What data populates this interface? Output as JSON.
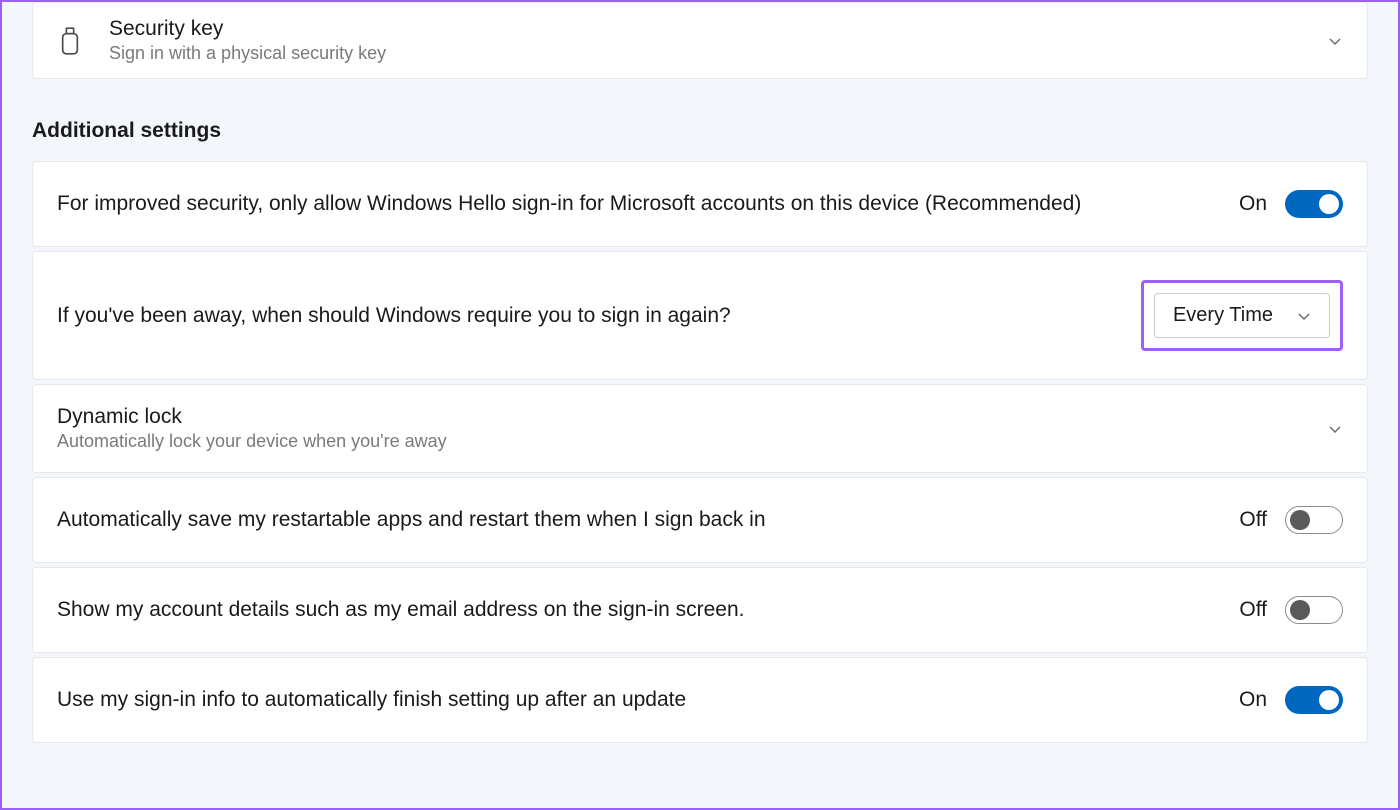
{
  "securityKey": {
    "title": "Security key",
    "subtitle": "Sign in with a physical security key"
  },
  "sectionHeading": "Additional settings",
  "helloSignIn": {
    "text": "For improved security, only allow Windows Hello sign-in for Microsoft accounts on this device (Recommended)",
    "stateLabel": "On"
  },
  "requireSignIn": {
    "text": "If you've been away, when should Windows require you to sign in again?",
    "dropdownValue": "Every Time"
  },
  "dynamicLock": {
    "title": "Dynamic lock",
    "subtitle": "Automatically lock your device when you're away"
  },
  "restartableApps": {
    "text": "Automatically save my restartable apps and restart them when I sign back in",
    "stateLabel": "Off"
  },
  "accountDetails": {
    "text": "Show my account details such as my email address on the sign-in screen.",
    "stateLabel": "Off"
  },
  "finishSetup": {
    "text": "Use my sign-in info to automatically finish setting up after an update",
    "stateLabel": "On"
  }
}
